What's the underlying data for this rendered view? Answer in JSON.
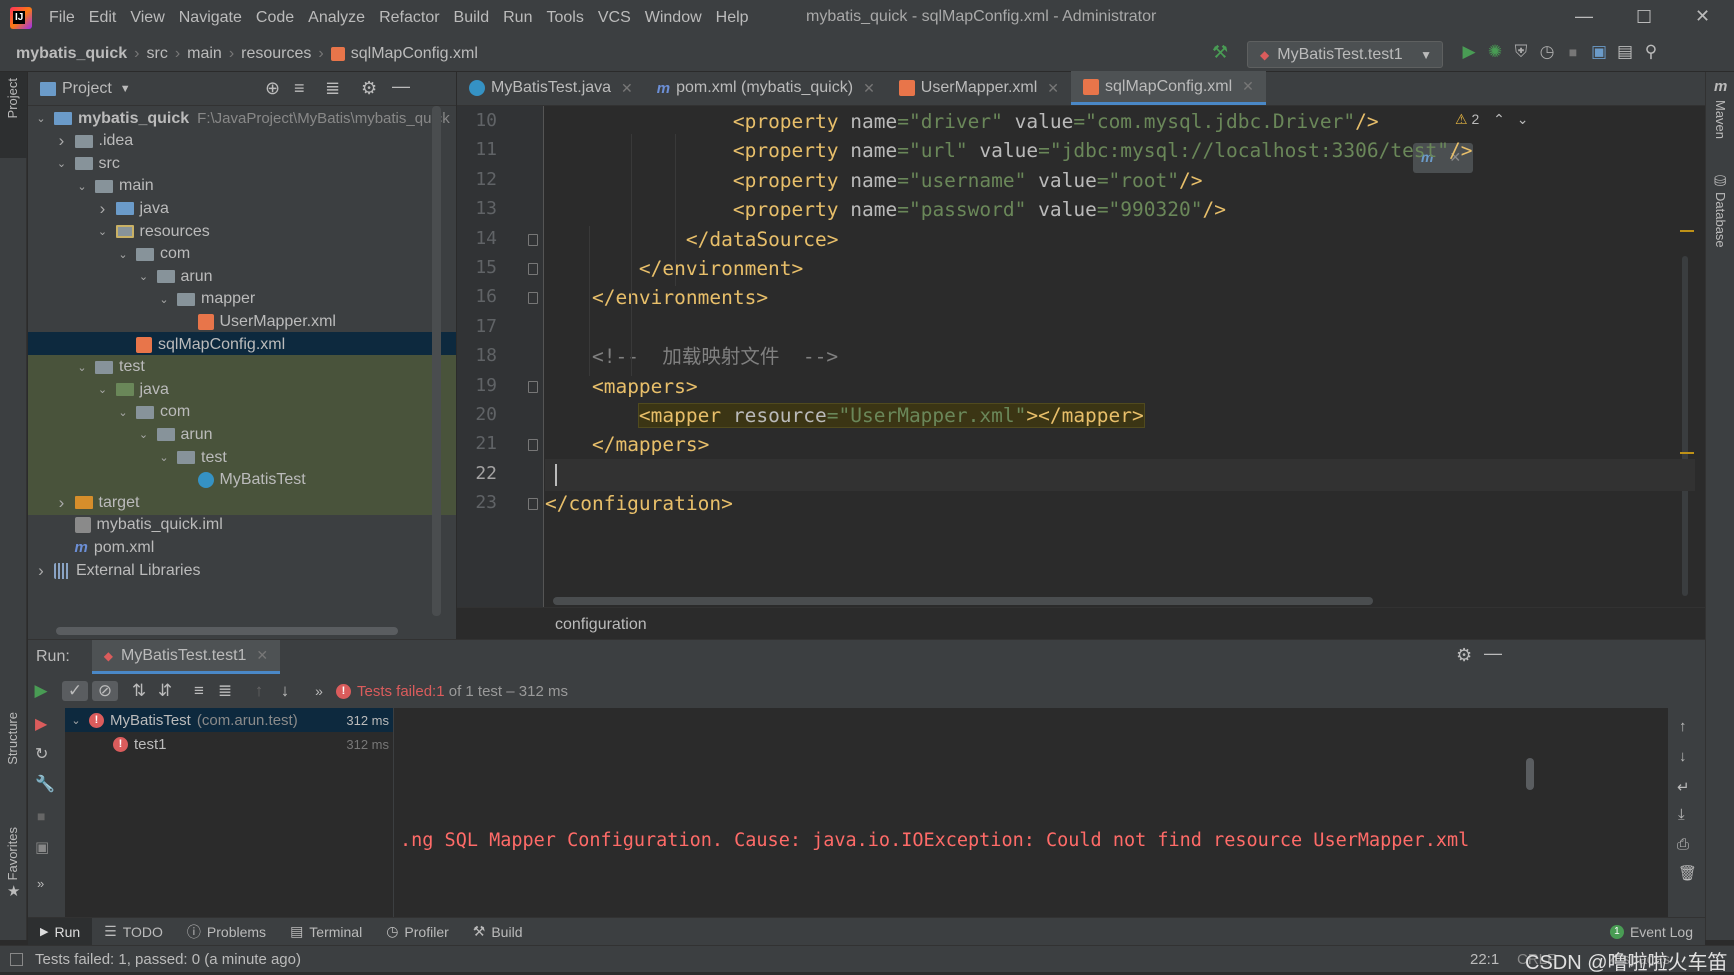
{
  "app": {
    "menu": [
      "File",
      "Edit",
      "View",
      "Navigate",
      "Code",
      "Analyze",
      "Refactor",
      "Build",
      "Run",
      "Tools",
      "VCS",
      "Window",
      "Help"
    ],
    "window_title": "mybatis_quick - sqlMapConfig.xml - Administrator"
  },
  "navbar": {
    "crumbs": [
      "mybatis_quick",
      "src",
      "main",
      "resources",
      "sqlMapConfig.xml"
    ],
    "run_config": "MyBatisTest.test1"
  },
  "left_strip": {
    "project": "Project",
    "structure": "Structure",
    "favorites": "Favorites"
  },
  "right_strip": {
    "maven": "Maven",
    "database": "Database"
  },
  "project": {
    "title": "Project",
    "tree": [
      {
        "label": "mybatis_quick",
        "path": "F:\\JavaProject\\MyBatis\\mybatis_quick",
        "icon": "module-folder-icon",
        "depth": 0,
        "arrow": "down",
        "bold": true
      },
      {
        "label": ".idea",
        "icon": "folder-icon",
        "depth": 1,
        "arrow": "right"
      },
      {
        "label": "src",
        "icon": "folder-icon",
        "depth": 1,
        "arrow": "down"
      },
      {
        "label": "main",
        "icon": "folder-icon",
        "depth": 2,
        "arrow": "down"
      },
      {
        "label": "java",
        "icon": "source-folder-icon",
        "depth": 3,
        "arrow": "right"
      },
      {
        "label": "resources",
        "icon": "resources-folder-icon",
        "depth": 3,
        "arrow": "down"
      },
      {
        "label": "com",
        "icon": "folder-icon",
        "depth": 4,
        "arrow": "down"
      },
      {
        "label": "arun",
        "icon": "folder-icon",
        "depth": 5,
        "arrow": "down"
      },
      {
        "label": "mapper",
        "icon": "folder-icon",
        "depth": 6,
        "arrow": "down"
      },
      {
        "label": "UserMapper.xml",
        "icon": "xml-file-icon",
        "depth": 7,
        "arrow": ""
      },
      {
        "label": "sqlMapConfig.xml",
        "icon": "xml-file-icon",
        "depth": 4,
        "arrow": "",
        "selected": true
      },
      {
        "label": "test",
        "icon": "folder-icon",
        "depth": 2,
        "arrow": "down",
        "test": true
      },
      {
        "label": "java",
        "icon": "test-source-folder-icon",
        "depth": 3,
        "arrow": "down",
        "test": true
      },
      {
        "label": "com",
        "icon": "package-icon",
        "depth": 4,
        "arrow": "down",
        "test": true
      },
      {
        "label": "arun",
        "icon": "package-icon",
        "depth": 5,
        "arrow": "down",
        "test": true
      },
      {
        "label": "test",
        "icon": "package-icon",
        "depth": 6,
        "arrow": "down",
        "test": true
      },
      {
        "label": "MyBatisTest",
        "icon": "java-class-icon",
        "depth": 7,
        "arrow": "",
        "test": true
      },
      {
        "label": "target",
        "icon": "excluded-folder-icon",
        "depth": 1,
        "arrow": "right",
        "test": true
      },
      {
        "label": "mybatis_quick.iml",
        "icon": "iml-file-icon",
        "depth": 1,
        "arrow": ""
      },
      {
        "label": "pom.xml",
        "icon": "maven-file-icon",
        "depth": 1,
        "arrow": ""
      },
      {
        "label": "External Libraries",
        "icon": "libraries-icon",
        "depth": 0,
        "arrow": "right"
      }
    ]
  },
  "editor": {
    "tabs": [
      {
        "label": "MyBatisTest.java",
        "icon": "java-class-icon",
        "active": false
      },
      {
        "label": "pom.xml (mybatis_quick)",
        "icon": "maven-file-icon",
        "active": false
      },
      {
        "label": "UserMapper.xml",
        "icon": "xml-file-icon",
        "active": false
      },
      {
        "label": "sqlMapConfig.xml",
        "icon": "xml-file-icon",
        "active": true
      }
    ],
    "warnings": "2",
    "lines": [
      {
        "n": "10",
        "html": "                <span class='tag'>&lt;property </span><span class='attr'>name</span><span class='val'>=\"driver\"</span> <span class='attr'>value</span><span class='val'>=\"com.mysql.jdbc.Driver\"</span><span class='tag'>/&gt;</span>"
      },
      {
        "n": "11",
        "html": "                <span class='tag'>&lt;property </span><span class='attr'>name</span><span class='val'>=\"url\"</span> <span class='attr'>value</span><span class='val'>=\"jdbc:mysql://localhost:3306/test\"</span><span class='tag'>/&gt;</span>"
      },
      {
        "n": "12",
        "html": "                <span class='tag'>&lt;property </span><span class='attr'>name</span><span class='val'>=\"username\"</span> <span class='attr'>value</span><span class='val'>=\"root\"</span><span class='tag'>/&gt;</span>"
      },
      {
        "n": "13",
        "html": "                <span class='tag'>&lt;property </span><span class='attr'>name</span><span class='val'>=\"password\"</span> <span class='attr'>value</span><span class='val'>=\"990320\"</span><span class='tag'>/&gt;</span>"
      },
      {
        "n": "14",
        "html": "            <span class='tag'>&lt;/dataSource&gt;</span>"
      },
      {
        "n": "15",
        "html": "        <span class='tag'>&lt;/environment&gt;</span>"
      },
      {
        "n": "16",
        "html": "    <span class='tag'>&lt;/environments&gt;</span>"
      },
      {
        "n": "17",
        "html": ""
      },
      {
        "n": "18",
        "html": "    <span class='cmt'>&lt;!--  加载映射文件  --&gt;</span>"
      },
      {
        "n": "19",
        "html": "    <span class='tag'>&lt;mappers&gt;</span>"
      },
      {
        "n": "20",
        "html": "        <span class='hl'><span class='tag'>&lt;mapper </span><span class='attr'>resource</span><span class='val'>=\"UserMapper.xml\"</span><span class='tag'>&gt;&lt;/mapper&gt;</span></span>"
      },
      {
        "n": "21",
        "html": "    <span class='tag'>&lt;/mappers&gt;</span>"
      },
      {
        "n": "22",
        "html": "",
        "current": true
      },
      {
        "n": "23",
        "html": "<span class='tag'>&lt;/configuration&gt;</span>"
      }
    ],
    "breadcrumb": "configuration"
  },
  "run": {
    "label": "Run:",
    "tab": "MyBatisTest.test1",
    "status_prefix": "Tests failed: ",
    "status_count": "1",
    "status_suffix": " of 1 test – 312 ms",
    "tree": [
      {
        "name": "MyBatisTest",
        "pkg": "(com.arun.test)",
        "time": "312 ms"
      },
      {
        "name": "test1",
        "pkg": "",
        "time": "312 ms"
      }
    ],
    "console_line": ".ng SQL Mapper Configuration. Cause: java.io.IOException: Could not find resource UserMapper.xml"
  },
  "bottom_tabs": [
    "Run",
    "TODO",
    "Problems",
    "Terminal",
    "Profiler",
    "Build"
  ],
  "event_log": {
    "count": "1",
    "label": "Event Log"
  },
  "status": {
    "text": "Tests failed: 1, passed: 0 (a minute ago)",
    "position": "22:1",
    "line_sep": "CRLF",
    "watermark": "CSDN @噜啦啦火车笛",
    "indent": "4 spaces"
  },
  "colors": {
    "accent": "#4a88c7",
    "error": "#db5c5c",
    "selection": "#0d293e",
    "test_bg": "#49533b"
  }
}
